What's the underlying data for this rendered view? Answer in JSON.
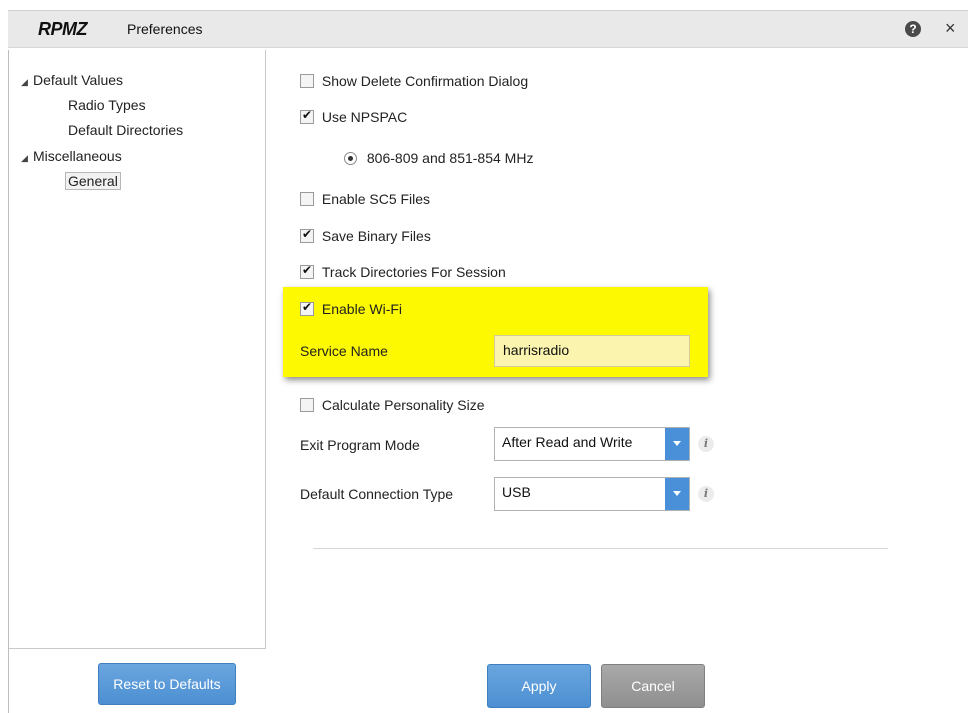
{
  "window": {
    "logo": "RPMZ",
    "title": "Preferences",
    "help_glyph": "?",
    "close_glyph": "×"
  },
  "tree": {
    "default_values": "Default Values",
    "radio_types": "Radio Types",
    "default_directories": "Default Directories",
    "miscellaneous": "Miscellaneous",
    "general": "General"
  },
  "settings": {
    "show_delete_confirmation": {
      "label": "Show Delete Confirmation Dialog",
      "checked": false
    },
    "use_npspac": {
      "label": "Use NPSPAC",
      "checked": true
    },
    "npspac_band": {
      "label": "806-809 and 851-854 MHz",
      "selected": true
    },
    "enable_sc5": {
      "label": "Enable SC5 Files",
      "checked": false
    },
    "save_binary": {
      "label": "Save Binary Files",
      "checked": true
    },
    "track_directories": {
      "label": "Track Directories For Session",
      "checked": true
    },
    "enable_wifi": {
      "label": "Enable Wi-Fi",
      "checked": true
    },
    "service_name": {
      "label": "Service Name",
      "value": "harrisradio"
    },
    "calculate_personality": {
      "label": "Calculate Personality Size",
      "checked": false
    },
    "exit_program_mode": {
      "label": "Exit Program Mode",
      "value": "After Read and Write"
    },
    "default_connection_type": {
      "label": "Default Connection Type",
      "value": "USB"
    }
  },
  "buttons": {
    "reset": "Reset to Defaults",
    "apply": "Apply",
    "cancel": "Cancel"
  },
  "colors": {
    "highlight": "#fdf900",
    "accent_blue": "#4c8fd2",
    "cancel_gray": "#8f8f8f"
  }
}
